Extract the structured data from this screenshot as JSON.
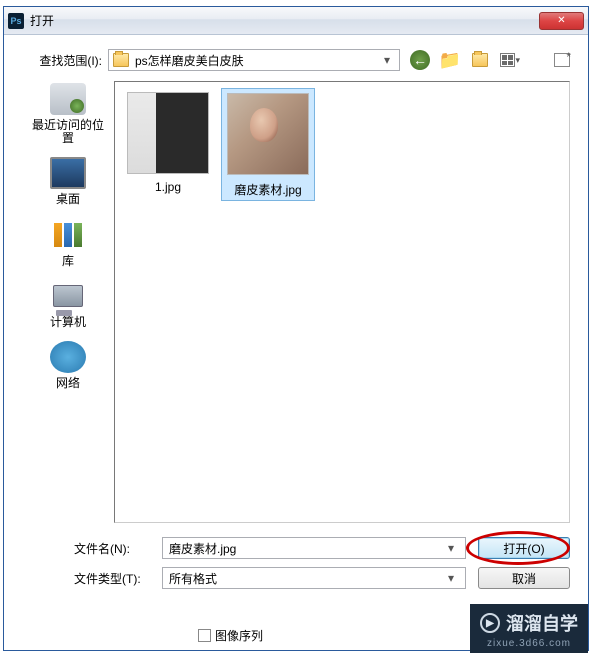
{
  "window": {
    "title": "打开",
    "close_glyph": "✕"
  },
  "lookin": {
    "label": "查找范围(I):",
    "path": "ps怎样磨皮美白皮肤"
  },
  "sidebar": {
    "items": [
      {
        "label": "最近访问的位置"
      },
      {
        "label": "桌面"
      },
      {
        "label": "库"
      },
      {
        "label": "计算机"
      },
      {
        "label": "网络"
      }
    ]
  },
  "files": {
    "items": [
      {
        "name": "1.jpg",
        "selected": false
      },
      {
        "name": "磨皮素材.jpg",
        "selected": true
      }
    ]
  },
  "form": {
    "filename_label": "文件名(N):",
    "filename_value": "磨皮素材.jpg",
    "filetype_label": "文件类型(T):",
    "filetype_value": "所有格式",
    "open_btn": "打开(O)",
    "cancel_btn": "取消",
    "sequence_label": "图像序列"
  },
  "watermark": {
    "brand": "溜溜自学",
    "url": "zixue.3d66.com"
  }
}
